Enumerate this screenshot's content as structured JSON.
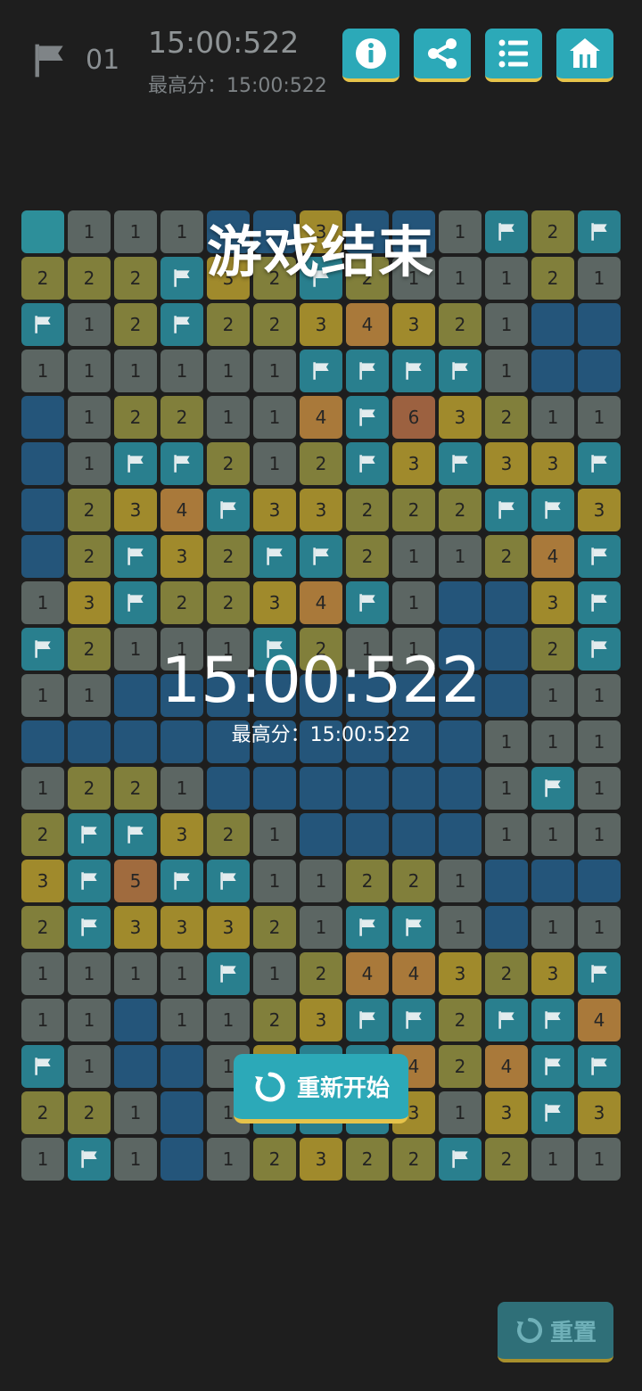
{
  "hud": {
    "flags_remaining": "01",
    "time": "15:00:522",
    "best_score": "最高分：15:00:522"
  },
  "toolbar": {
    "info_icon": "info-icon",
    "share_icon": "share-icon",
    "list_icon": "list-icon",
    "home_icon": "home-icon"
  },
  "board": {
    "columns": 13,
    "rows": [
      [
        "0",
        "1",
        "1",
        "1",
        "h",
        "h",
        "3",
        "h",
        "h",
        "1",
        "f",
        "2",
        "f"
      ],
      [
        "2",
        "2",
        "2",
        "f",
        "3",
        "2",
        "f",
        "2",
        "1",
        "1",
        "1",
        "2",
        "1"
      ],
      [
        "f",
        "1",
        "2",
        "f",
        "2",
        "2",
        "3",
        "4",
        "3",
        "2",
        "1",
        "h",
        "h"
      ],
      [
        "1",
        "1",
        "1",
        "1",
        "1",
        "1",
        "f",
        "f",
        "f",
        "f",
        "1",
        "h",
        "h"
      ],
      [
        "h",
        "1",
        "2",
        "2",
        "1",
        "1",
        "4",
        "f",
        "6",
        "3",
        "2",
        "1",
        "1"
      ],
      [
        "h",
        "1",
        "f",
        "f",
        "2",
        "1",
        "2",
        "f",
        "3",
        "f",
        "3",
        "3",
        "f"
      ],
      [
        "h",
        "2",
        "3",
        "4",
        "f",
        "3",
        "3",
        "2",
        "2",
        "2",
        "f",
        "f",
        "3"
      ],
      [
        "h",
        "2",
        "f",
        "3",
        "2",
        "f",
        "f",
        "2",
        "1",
        "1",
        "2",
        "4",
        "f"
      ],
      [
        "1",
        "3",
        "f",
        "2",
        "2",
        "3",
        "4",
        "f",
        "1",
        "h",
        "h",
        "3",
        "f"
      ],
      [
        "f",
        "2",
        "1",
        "1",
        "1",
        "f",
        "2",
        "1",
        "1",
        "h",
        "h",
        "2",
        "f"
      ],
      [
        "1",
        "1",
        "h",
        "h",
        "h",
        "h",
        "h",
        "h",
        "h",
        "h",
        "h",
        "1",
        "1"
      ],
      [
        "h",
        "h",
        "h",
        "h",
        "h",
        "h",
        "h",
        "h",
        "h",
        "h",
        "1",
        "1",
        "1"
      ],
      [
        "1",
        "2",
        "2",
        "1",
        "h",
        "h",
        "h",
        "h",
        "h",
        "h",
        "1",
        "f",
        "1"
      ],
      [
        "2",
        "f",
        "f",
        "3",
        "2",
        "1",
        "h",
        "h",
        "h",
        "h",
        "1",
        "1",
        "1"
      ],
      [
        "3",
        "f",
        "5",
        "f",
        "f",
        "1",
        "1",
        "2",
        "2",
        "1",
        "h",
        "h",
        "h"
      ],
      [
        "2",
        "f",
        "3",
        "3",
        "3",
        "2",
        "1",
        "f",
        "f",
        "1",
        "h",
        "1",
        "1"
      ],
      [
        "1",
        "1",
        "1",
        "1",
        "f",
        "1",
        "2",
        "4",
        "4",
        "3",
        "2",
        "3",
        "f"
      ],
      [
        "1",
        "1",
        "h",
        "1",
        "1",
        "2",
        "3",
        "f",
        "f",
        "2",
        "f",
        "f",
        "4"
      ],
      [
        "f",
        "1",
        "h",
        "h",
        "1",
        "3",
        "f",
        "f",
        "4",
        "2",
        "4",
        "f",
        "f"
      ],
      [
        "2",
        "2",
        "1",
        "h",
        "1",
        "f",
        "f",
        "f",
        "3",
        "1",
        "3",
        "f",
        "3"
      ],
      [
        "1",
        "f",
        "1",
        "h",
        "1",
        "2",
        "3",
        "2",
        "2",
        "f",
        "2",
        "1",
        "1"
      ]
    ]
  },
  "overlay": {
    "title": "游戏结束",
    "time": "15:00:522",
    "best_score": "最高分：15:00:522",
    "restart_label": "重新开始"
  },
  "footer": {
    "reset_label": "重置"
  },
  "colors": {
    "accent": "#2ca9b8",
    "accent_border": "#e6c34a",
    "hidden_cell": "#24557a",
    "flag_cell": "#297f8e",
    "background": "#1e1e1e"
  }
}
